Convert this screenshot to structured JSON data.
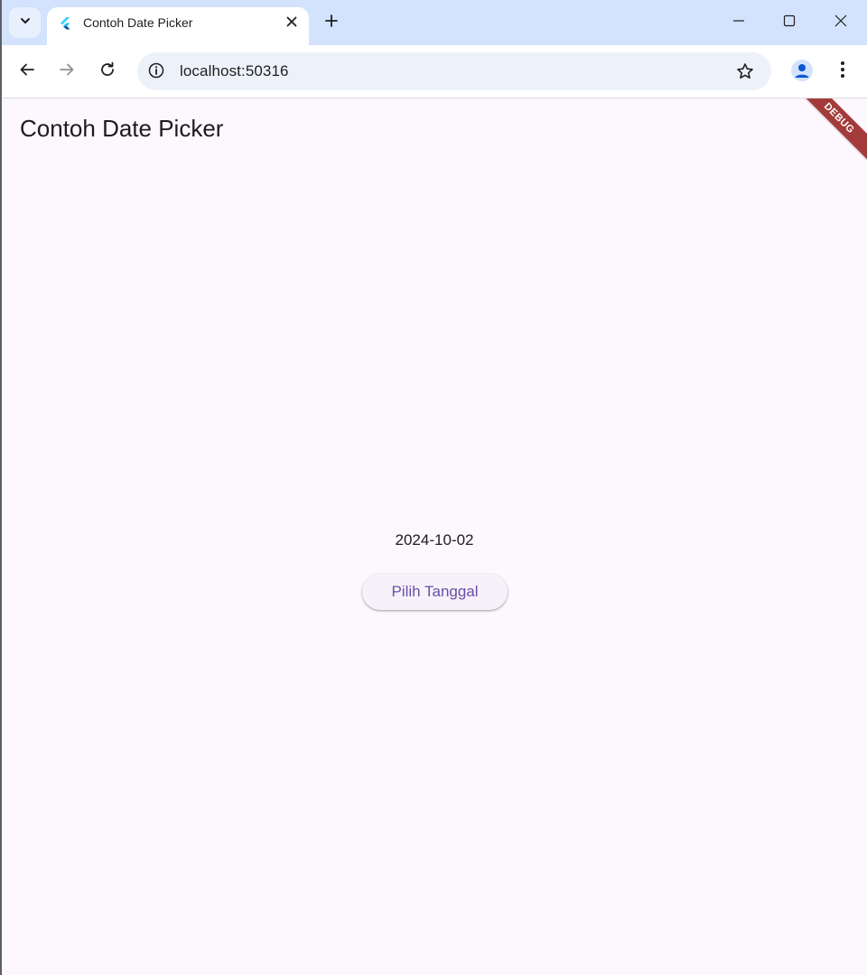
{
  "browser": {
    "tab": {
      "title": "Contoh Date Picker"
    },
    "address_bar": {
      "url": "localhost:50316"
    },
    "icons": {
      "tab_search": "chevron-down-icon",
      "favicon": "flutter-logo-icon",
      "close_tab": "close-icon",
      "new_tab": "plus-icon",
      "minimize": "minimize-icon",
      "maximize": "maximize-icon",
      "close_window": "close-icon",
      "back": "arrow-left-icon",
      "forward": "arrow-right-icon",
      "reload": "reload-icon",
      "site_info": "info-icon",
      "bookmark": "star-icon",
      "profile": "person-icon",
      "menu": "kebab-menu-icon"
    },
    "colors": {
      "tabstrip": "#d3e3fd",
      "omnibox": "#edf2fa"
    }
  },
  "app": {
    "title": "Contoh Date Picker",
    "selected_date": "2024-10-02",
    "pick_button_label": "Pilih Tanggal",
    "debug_banner": "DEBUG",
    "colors": {
      "background": "#fdf7fe",
      "button_text": "#6750a4",
      "debug_banner": "#a33b3b"
    }
  }
}
